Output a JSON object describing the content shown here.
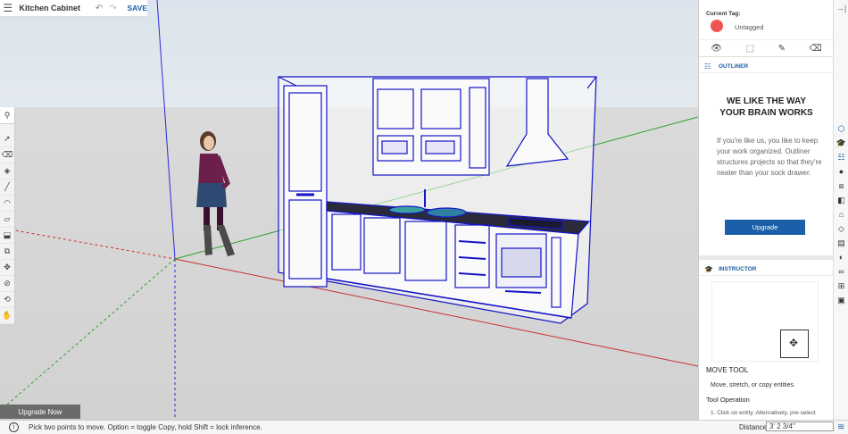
{
  "topbar": {
    "menu_icon": "hamburger-icon",
    "title": "Kitchen Cabinet",
    "undo_icon": "undo-icon",
    "redo_icon": "redo-icon",
    "save_label": "SAVE"
  },
  "toolbar": {
    "search_icon": "search-icon",
    "tools": [
      "select-icon",
      "eraser-icon",
      "paint-bucket-icon",
      "line-icon",
      "arc-icon",
      "rectangle-icon",
      "push-pull-icon",
      "offset-icon",
      "move-icon",
      "tape-measure-icon",
      "orbit-icon",
      "pan-icon"
    ]
  },
  "upgrade_now_label": "Upgrade Now",
  "status": {
    "message": "Pick two points to move. Option = toggle Copy, hold Shift = lock inference.",
    "distance_label": "Distance",
    "distance_value": "3' 2 3/4\""
  },
  "tag_panel": {
    "label": "Current Tag:",
    "tag_name": "Untagged",
    "tag_color": "#ef5555"
  },
  "outliner": {
    "header": "OUTLINER",
    "title_line1": "WE LIKE THE WAY",
    "title_line2": "YOUR BRAIN WORKS",
    "body": "If you're like us, you like to keep your work organized. Outliner structures projects so that they're neater than your sock drawer.",
    "button_label": "Upgrade"
  },
  "instructor": {
    "header": "INSTRUCTOR",
    "tool_name": "MOVE TOOL",
    "tool_desc": "Move, stretch, or copy entities.",
    "operation_title": "Tool Operation",
    "step1": "1. Click on entity. Alternatively, pre-select"
  },
  "colors": {
    "accent": "#1a5fa8",
    "selection": "#1414c8",
    "tag_dot": "#ef5555"
  }
}
